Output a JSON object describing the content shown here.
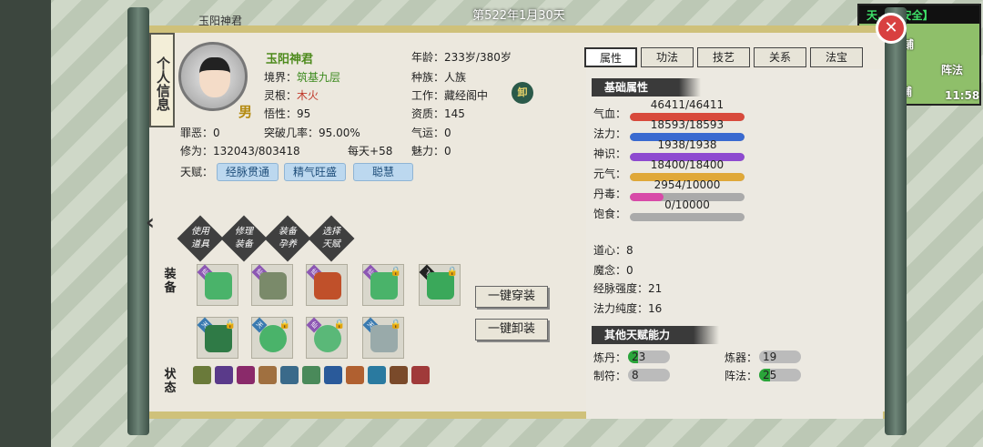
{
  "header": {
    "date": "第522年1月30天",
    "top_name": "玉阳神君"
  },
  "minimap": {
    "title": "天...【安全】",
    "labels": [
      "路铺",
      "阵法",
      "摆铺"
    ],
    "time": "11:58"
  },
  "panel_title": "个人信息",
  "profile": {
    "name": "玉阳神君",
    "gender": "男",
    "realm_label": "境界：",
    "realm": "筑基九层",
    "root_label": "灵根：",
    "root": "木火",
    "insight_label": "悟性：",
    "insight": "95",
    "sin_label": "罪恶：",
    "sin": "0",
    "breakthrough_label": "突破几率：",
    "breakthrough": "95.00%",
    "cultivation_label": "修为：",
    "cultivation": "132043/803418",
    "daily_label": "每天+",
    "daily": "58",
    "age_label": "年龄：",
    "age": "233岁/380岁",
    "race_label": "种族：",
    "race": "人族",
    "job_label": "工作：",
    "job": "藏经阁中",
    "aptitude_label": "资质：",
    "aptitude": "145",
    "luck_label": "气运：",
    "luck": "0",
    "charm_label": "魅力：",
    "charm": "0",
    "unequip_icon_label": "卸"
  },
  "talents": {
    "label": "天赋：",
    "items": [
      "经脉贯通",
      "精气旺盛",
      "聪慧"
    ]
  },
  "actions": [
    {
      "line1": "使用",
      "line2": "道具"
    },
    {
      "line1": "修理",
      "line2": "装备"
    },
    {
      "line1": "装备",
      "line2": "孕养"
    },
    {
      "line1": "选择",
      "line2": "天赋"
    }
  ],
  "sections": {
    "equip": "装备",
    "status": "状态"
  },
  "buttons": {
    "equip_all": "一键穿装",
    "unequip_all": "一键卸装"
  },
  "tabs": [
    "属性",
    "功法",
    "技艺",
    "关系",
    "法宝"
  ],
  "basic": {
    "title": "基础属性",
    "bars": [
      {
        "label": "气血：",
        "value": "46411/46411",
        "fill": 1.0,
        "color": "#d84a3c"
      },
      {
        "label": "法力：",
        "value": "18593/18593",
        "fill": 1.0,
        "color": "#3a6ad0"
      },
      {
        "label": "神识：",
        "value": "1938/1938",
        "fill": 1.0,
        "color": "#8e4ad0"
      },
      {
        "label": "元气：",
        "value": "18400/18400",
        "fill": 1.0,
        "color": "#e0a838"
      },
      {
        "label": "丹毒：",
        "value": "2954/10000",
        "fill": 0.2954,
        "color": "#d84aa8"
      },
      {
        "label": "饱食：",
        "value": "0/10000",
        "fill": 0.0,
        "color": "#888888"
      }
    ],
    "stats": [
      {
        "label": "道心：",
        "value": "8"
      },
      {
        "label": "魔念：",
        "value": "0"
      },
      {
        "label": "经脉强度：",
        "value": "21"
      },
      {
        "label": "法力纯度：",
        "value": "16"
      }
    ]
  },
  "other": {
    "title": "其他天赋能力",
    "skills": [
      {
        "label": "炼丹：",
        "value": "23",
        "fill": 0.23
      },
      {
        "label": "炼器：",
        "value": "19",
        "fill": 0.0
      },
      {
        "label": "制符：",
        "value": "8",
        "fill": 0.0
      },
      {
        "label": "阵法：",
        "value": "25",
        "fill": 0.25
      }
    ]
  },
  "close_label": "✕"
}
